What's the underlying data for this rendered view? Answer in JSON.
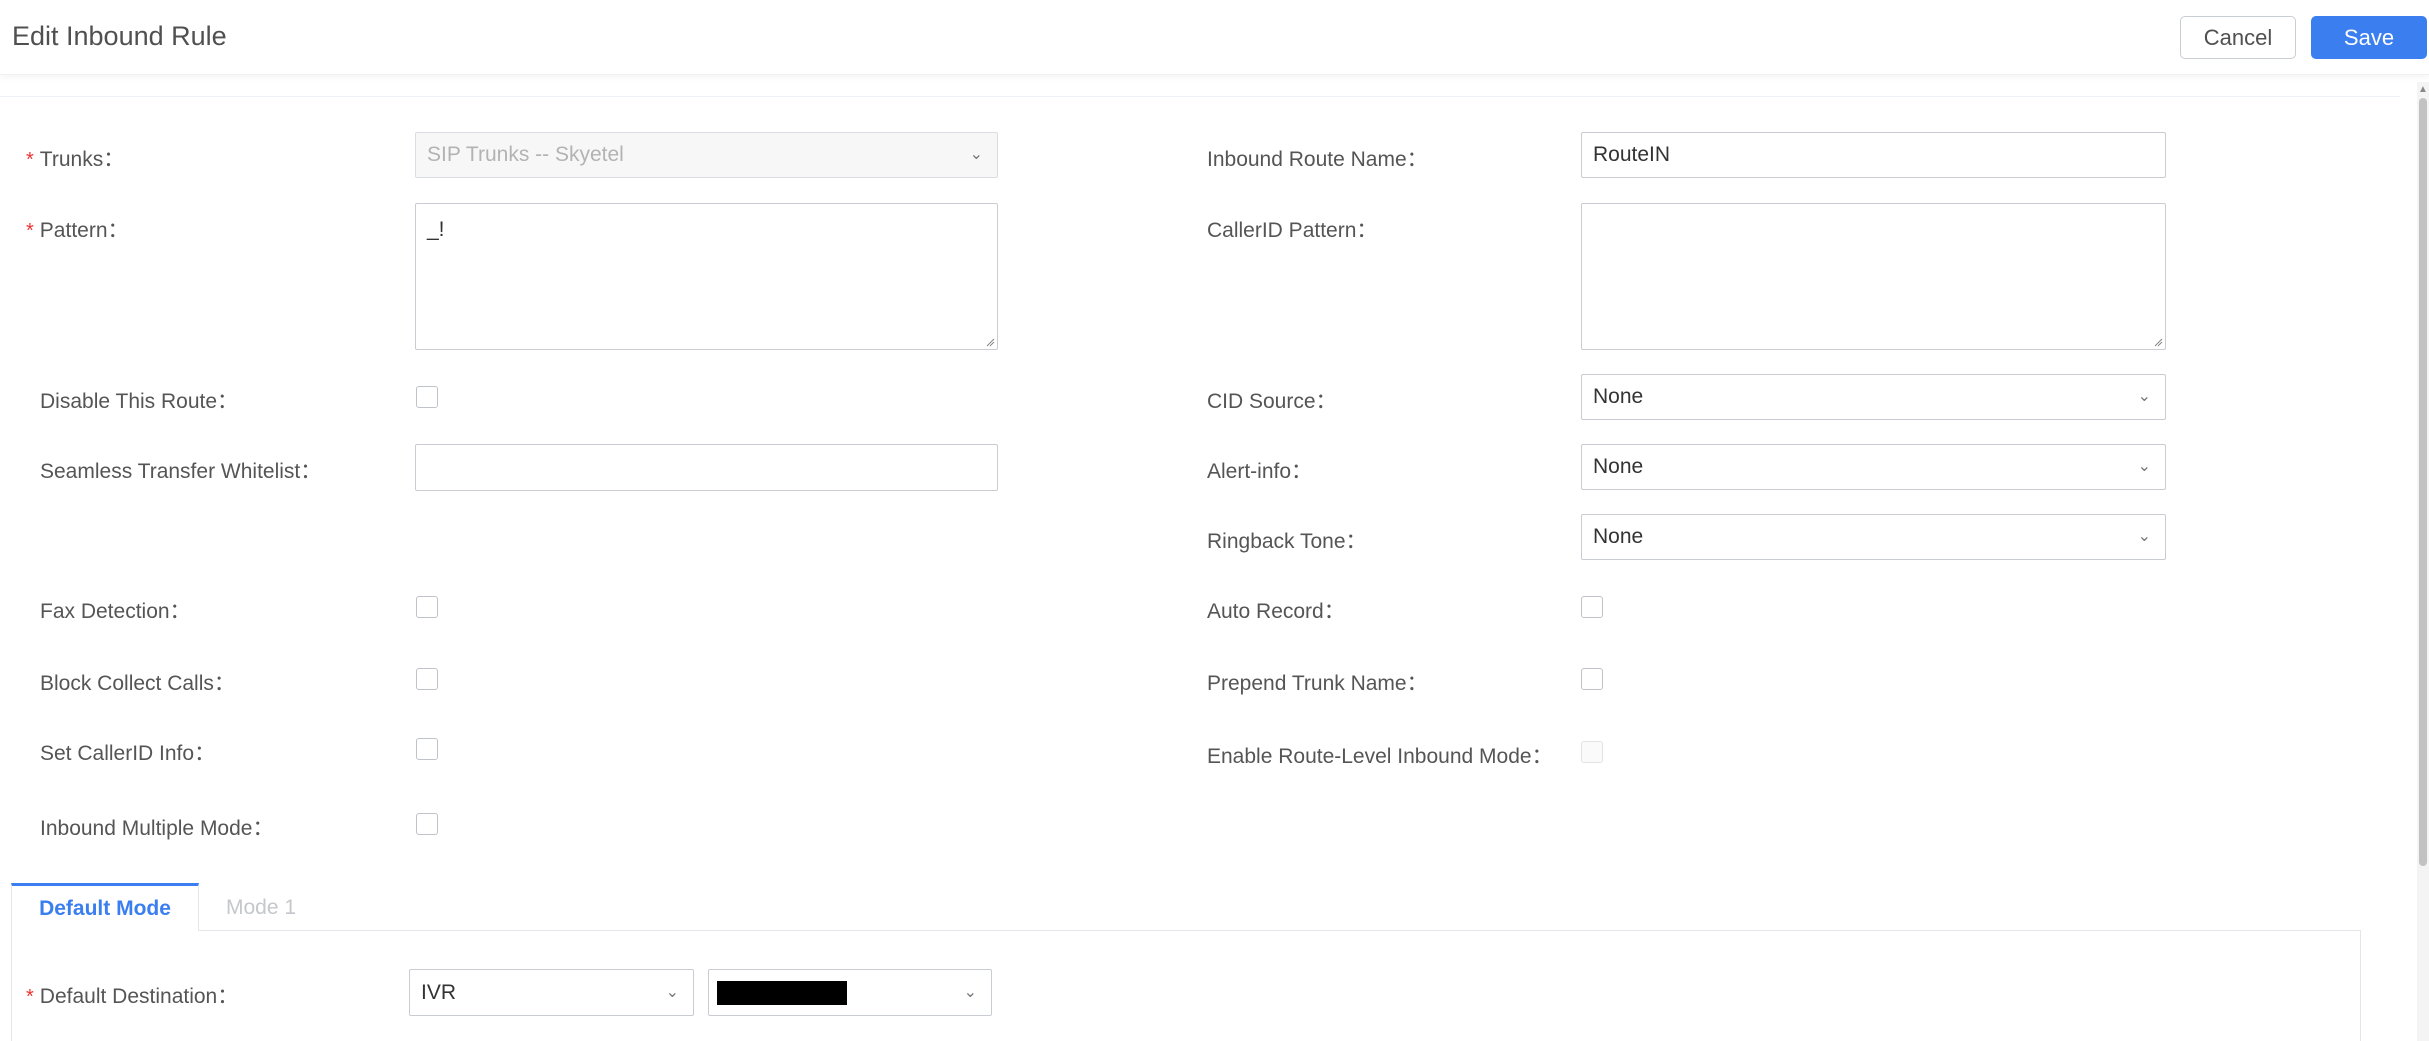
{
  "header": {
    "title": "Edit Inbound Rule",
    "cancel_label": "Cancel",
    "save_label": "Save"
  },
  "form": {
    "required_mark": "*",
    "trunks": {
      "label": "Trunks：",
      "value": "SIP Trunks -- Skyetel"
    },
    "pattern": {
      "label": "Pattern：",
      "value": "_!"
    },
    "disable_route": {
      "label": "Disable This Route：",
      "checked": false
    },
    "seamless_whitelist": {
      "label": "Seamless Transfer Whitelist：",
      "value": ""
    },
    "fax_detection": {
      "label": "Fax Detection：",
      "checked": false
    },
    "block_collect": {
      "label": "Block Collect Calls：",
      "checked": false
    },
    "set_callerid": {
      "label": "Set CallerID Info：",
      "checked": false
    },
    "inbound_multiple": {
      "label": "Inbound Multiple Mode：",
      "checked": false
    },
    "inbound_route_name": {
      "label": "Inbound Route Name：",
      "value": "RouteIN"
    },
    "callerid_pattern": {
      "label": "CallerID Pattern：",
      "value": ""
    },
    "cid_source": {
      "label": "CID Source：",
      "value": "None"
    },
    "alert_info": {
      "label": "Alert-info：",
      "value": "None"
    },
    "ringback_tone": {
      "label": "Ringback Tone：",
      "value": "None"
    },
    "auto_record": {
      "label": "Auto Record：",
      "checked": false
    },
    "prepend_trunk": {
      "label": "Prepend Trunk Name：",
      "checked": false
    },
    "route_level_inbound": {
      "label": "Enable Route-Level Inbound Mode：",
      "checked": false,
      "disabled": true
    }
  },
  "tabs": [
    {
      "label": "Default Mode",
      "active": true
    },
    {
      "label": "Mode 1",
      "active": false
    }
  ],
  "default_destination": {
    "label": "Default Destination：",
    "type_value": "IVR",
    "target_value": ""
  },
  "icons": {
    "chevron": "chevron-down-icon"
  },
  "colors": {
    "accent": "#3a7ef0",
    "required": "#e33333"
  }
}
